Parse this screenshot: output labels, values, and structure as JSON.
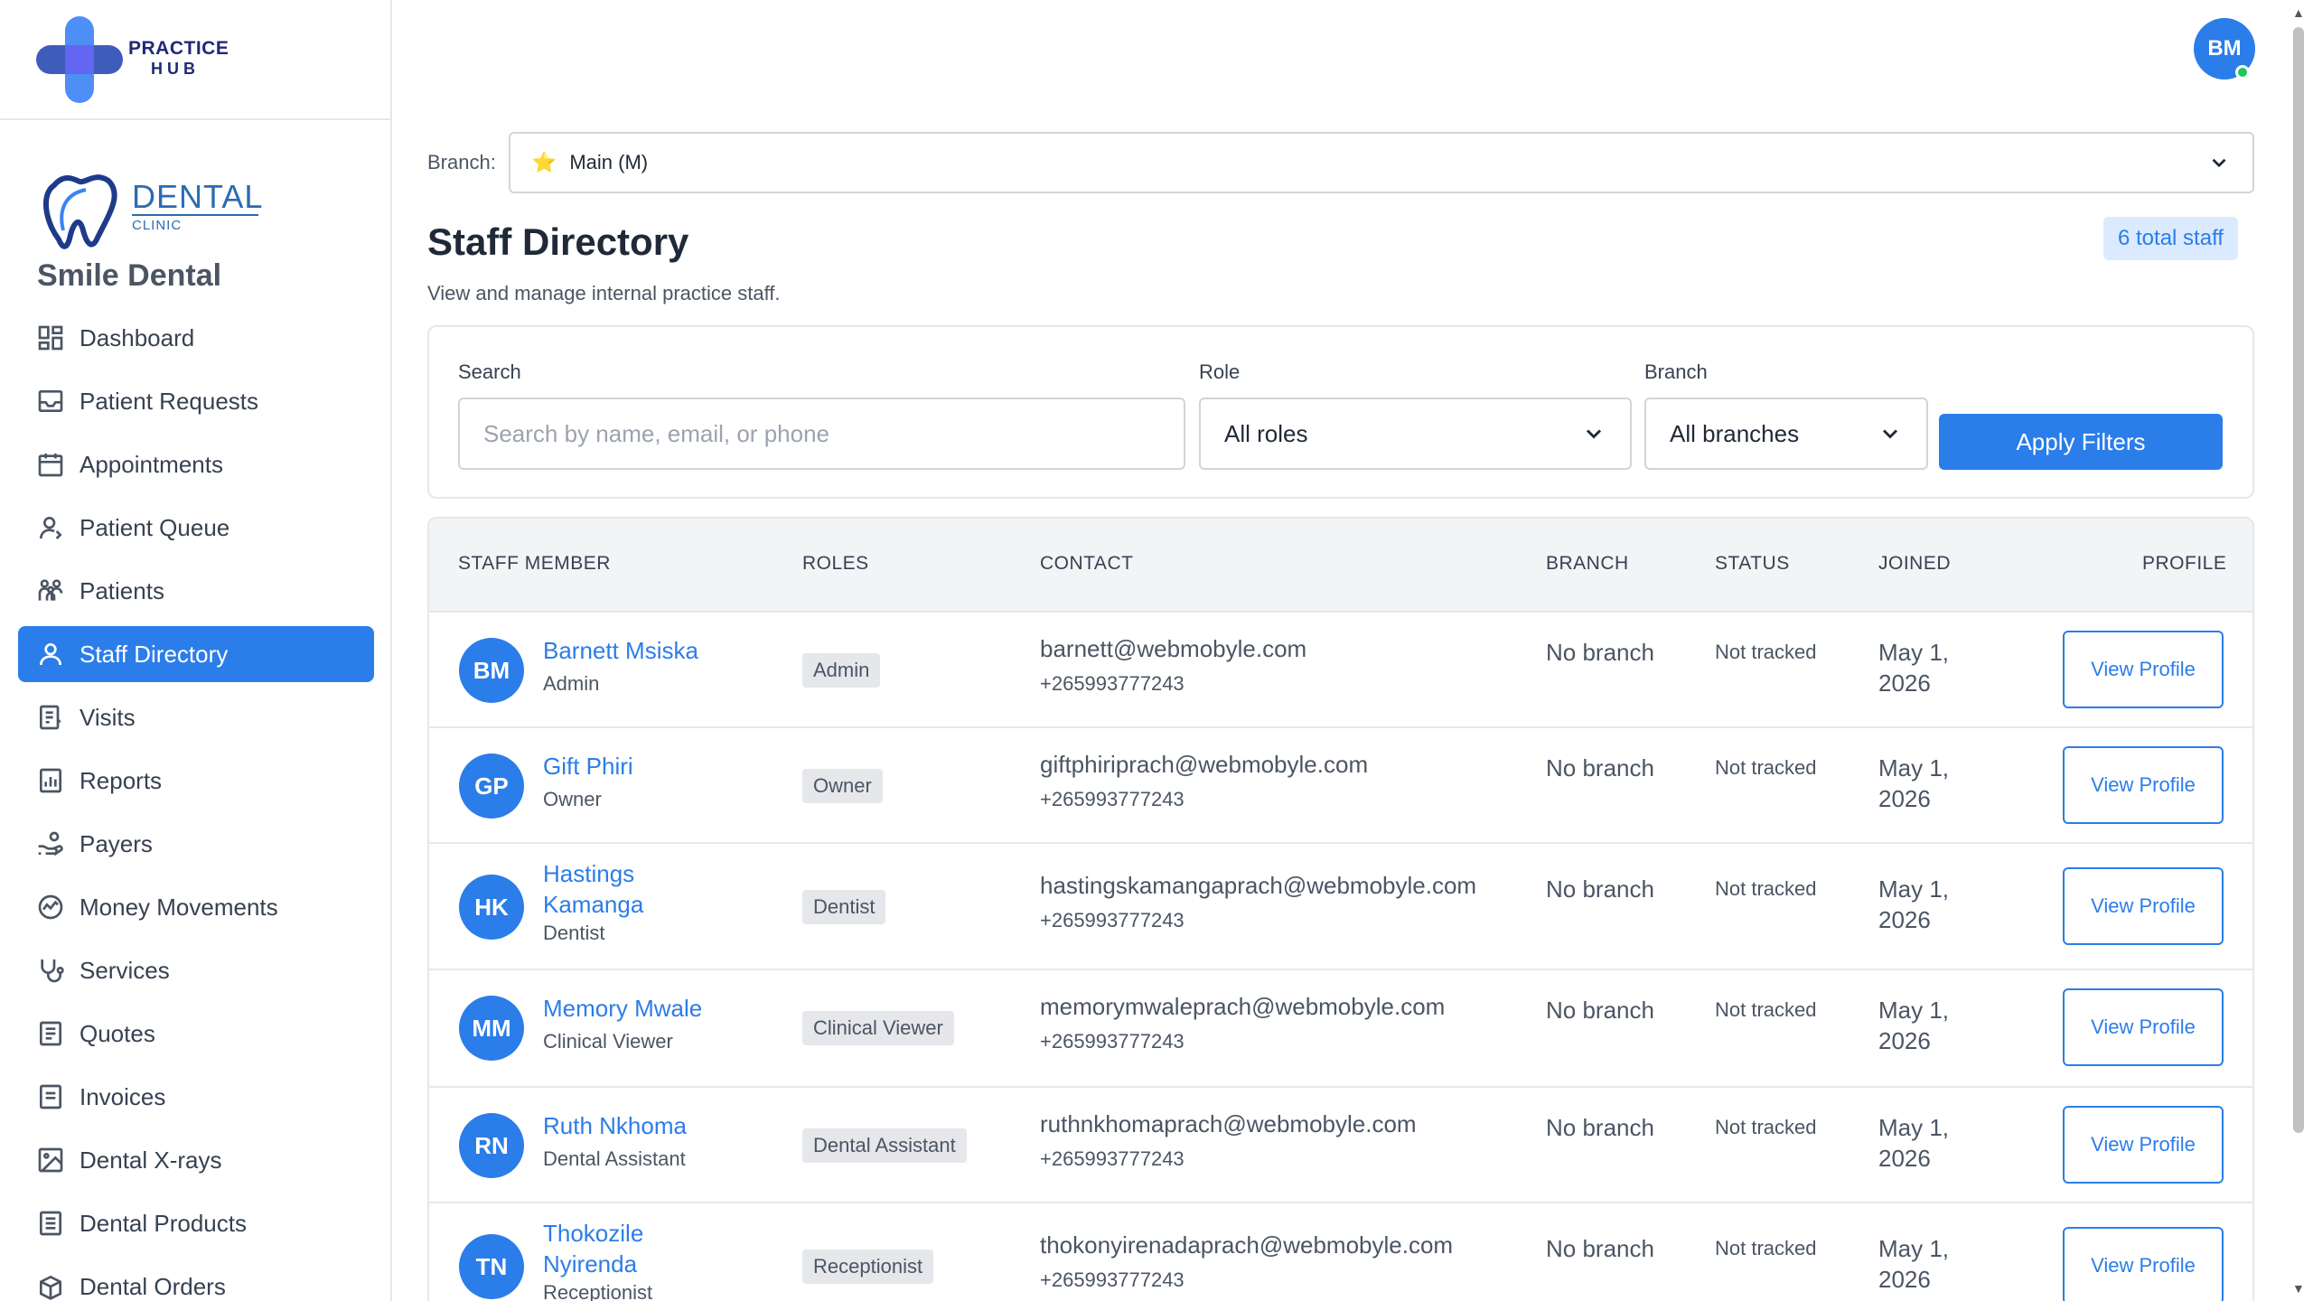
{
  "brand": {
    "practice": "PRACTICE",
    "hub": "HUB"
  },
  "clinic": {
    "logo_word": "DENTAL",
    "logo_sub": "CLINIC",
    "name": "Smile Dental"
  },
  "sidebar": {
    "items": [
      {
        "label": "Dashboard",
        "icon": "dashboard-icon"
      },
      {
        "label": "Patient Requests",
        "icon": "inbox-icon"
      },
      {
        "label": "Appointments",
        "icon": "calendar-icon"
      },
      {
        "label": "Patient Queue",
        "icon": "user-queue-icon"
      },
      {
        "label": "Patients",
        "icon": "people-icon"
      },
      {
        "label": "Staff Directory",
        "icon": "user-icon",
        "active": true
      },
      {
        "label": "Visits",
        "icon": "clipboard-icon"
      },
      {
        "label": "Reports",
        "icon": "report-icon"
      },
      {
        "label": "Payers",
        "icon": "hand-coins-icon"
      },
      {
        "label": "Money Movements",
        "icon": "money-flow-icon"
      },
      {
        "label": "Services",
        "icon": "stethoscope-icon"
      },
      {
        "label": "Quotes",
        "icon": "document-icon"
      },
      {
        "label": "Invoices",
        "icon": "invoice-icon"
      },
      {
        "label": "Dental X-rays",
        "icon": "image-icon"
      },
      {
        "label": "Dental Products",
        "icon": "product-icon"
      },
      {
        "label": "Dental Orders",
        "icon": "box-icon"
      }
    ]
  },
  "user": {
    "initials": "BM",
    "status_color": "#22c55e"
  },
  "branch_bar": {
    "label": "Branch:",
    "star": "⭐",
    "value": "Main (M)"
  },
  "page": {
    "title": "Staff Directory",
    "subtitle": "View and manage internal practice staff.",
    "total": "6 total staff"
  },
  "filters": {
    "search_label": "Search",
    "search_placeholder": "Search by name, email, or phone",
    "role_label": "Role",
    "role_value": "All roles",
    "branch_label": "Branch",
    "branch_value": "All branches",
    "apply": "Apply Filters"
  },
  "table": {
    "headers": [
      "STAFF MEMBER",
      "ROLES",
      "CONTACT",
      "BRANCH",
      "STATUS",
      "JOINED",
      "PROFILE"
    ],
    "rows": [
      {
        "initials": "BM",
        "name": "Barnett Msiska",
        "role": "Admin",
        "email": "barnett@webmobyle.com",
        "phone": "+265993777243",
        "branch": "No branch",
        "status": "Not tracked",
        "joined": "May 1, 2026",
        "action": "View Profile"
      },
      {
        "initials": "GP",
        "name": "Gift Phiri",
        "role": "Owner",
        "email": "giftphiriprach@webmobyle.com",
        "phone": "+265993777243",
        "branch": "No branch",
        "status": "Not tracked",
        "joined": "May 1, 2026",
        "action": "View Profile"
      },
      {
        "initials": "HK",
        "name": "Hastings Kamanga",
        "role": "Dentist",
        "email": "hastingskamangaprach@webmobyle.com",
        "phone": "+265993777243",
        "branch": "No branch",
        "status": "Not tracked",
        "joined": "May 1, 2026",
        "action": "View Profile"
      },
      {
        "initials": "MM",
        "name": "Memory Mwale",
        "role": "Clinical Viewer",
        "email": "memorymwaleprach@webmobyle.com",
        "phone": "+265993777243",
        "branch": "No branch",
        "status": "Not tracked",
        "joined": "May 1, 2026",
        "action": "View Profile"
      },
      {
        "initials": "RN",
        "name": "Ruth Nkhoma",
        "role": "Dental Assistant",
        "email": "ruthnkhomaprach@webmobyle.com",
        "phone": "+265993777243",
        "branch": "No branch",
        "status": "Not tracked",
        "joined": "May 1, 2026",
        "action": "View Profile"
      },
      {
        "initials": "TN",
        "name": "Thokozile Nyirenda",
        "role": "Receptionist",
        "email": "thokonyirenadaprach@webmobyle.com",
        "phone": "+265993777243",
        "branch": "No branch",
        "status": "Not tracked",
        "joined": "May 1, 2026",
        "action": "View Profile"
      }
    ]
  },
  "colors": {
    "accent": "#2b7de9",
    "brand_navy": "#1e2a78",
    "badge_bg": "#dbeafe"
  }
}
